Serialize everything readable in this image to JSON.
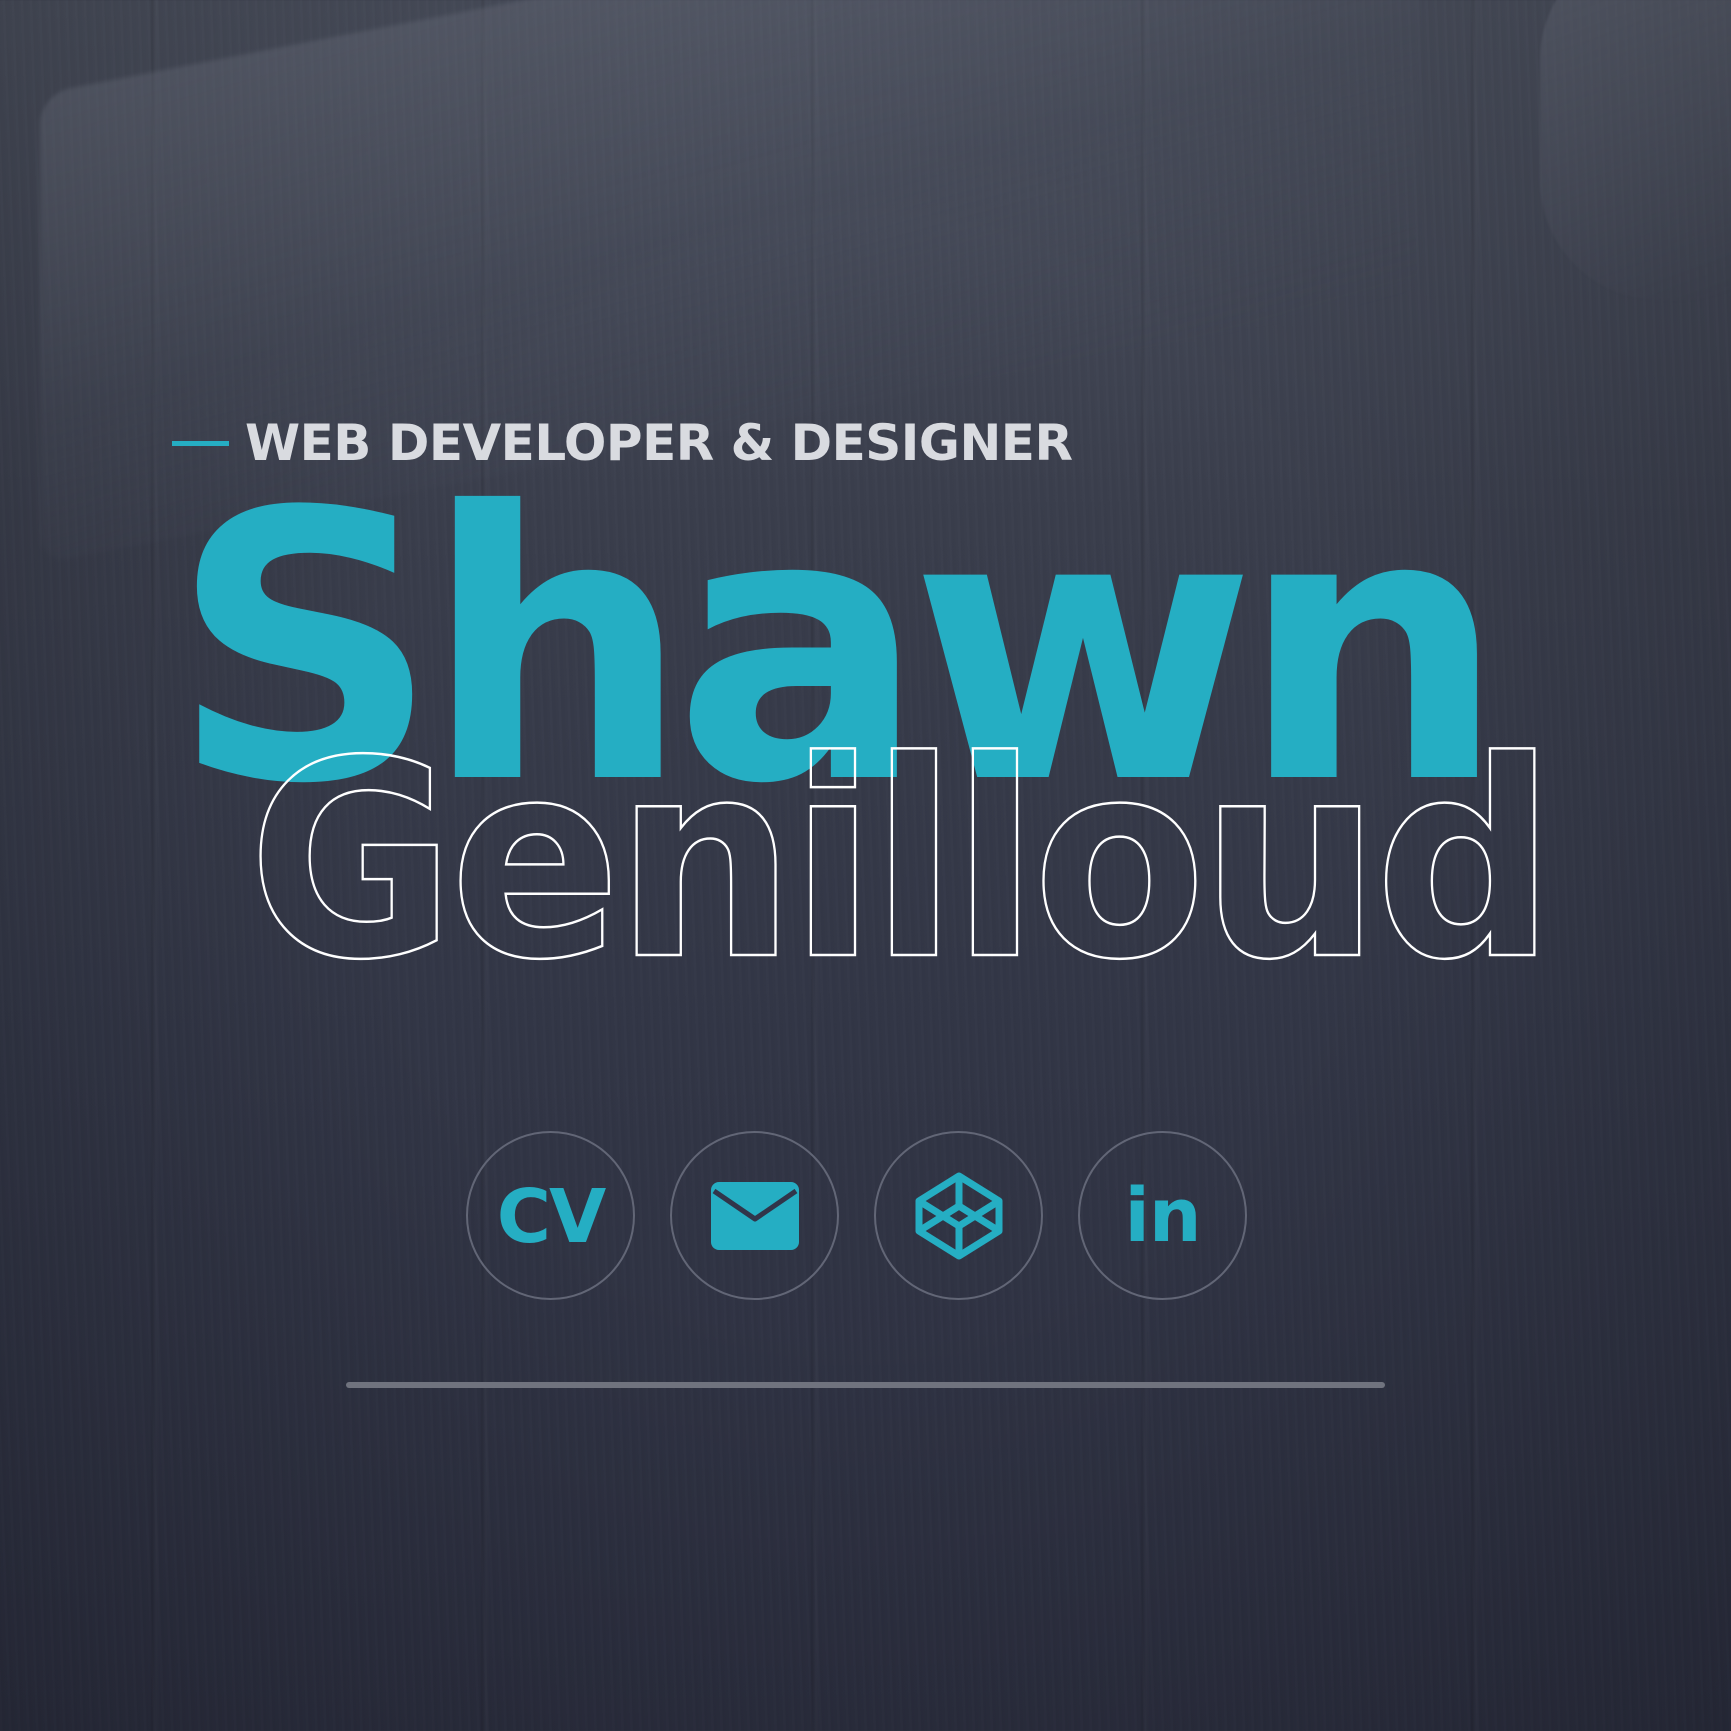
{
  "hero": {
    "subtitle": "WEB DEVELOPER & DESIGNER",
    "first_name": "Shawn",
    "last_name": "Genilloud"
  },
  "socials": [
    {
      "label": "CV",
      "icon": "cv-icon"
    },
    {
      "label": "",
      "icon": "envelope-icon"
    },
    {
      "label": "",
      "icon": "codepen-icon"
    },
    {
      "label": "in",
      "icon": "linkedin-icon"
    }
  ],
  "colors": {
    "accent": "#25aec3",
    "subtitle": "#d9dbe0",
    "outline": "#ffffff",
    "background": "#2f3242",
    "circle_border": "#626676",
    "divider": "#70737e"
  }
}
